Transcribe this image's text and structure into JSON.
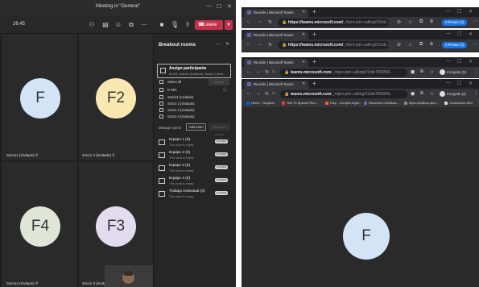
{
  "teams": {
    "window_title": "Meeting in \"General\"",
    "window_controls": [
      "—",
      "☐",
      "✕"
    ],
    "timer": "26:45",
    "leave_label": "Leave",
    "participants": [
      {
        "initials": "F",
        "name": "Sctcio1 (Invitado)",
        "color": "#d2e4f5"
      },
      {
        "initials": "F2",
        "name": "Sctcio 2 (Invitado)",
        "color": "#fbe7b0"
      },
      {
        "initials": "F4",
        "name": "Sctcio4 (Invitado)",
        "color": "#dfe6d8"
      },
      {
        "initials": "F3",
        "name": "Sctcio 3 (Invitado)",
        "color": "#e3dcf1"
      }
    ],
    "breakout": {
      "title": "Breakout rooms",
      "assign_title": "Assign participants",
      "assign_subtitle": "IA MG, Sctcio1 (Invitado), Sctcio 2 (Invit...",
      "assign_button": "Assign",
      "select_all": "Select all",
      "people": [
        "IA MG",
        "Sctcio1 (Invitado)",
        "Sctcio 2 (Invitado)",
        "Sctcio 3 (Invitado)",
        "Sctcio 4 (Invitado)"
      ],
      "manage_rooms": "Manage rooms",
      "add_room": "Add room",
      "recreate": "Recreate rooms",
      "rooms": [
        {
          "name": "Equipo 1 (0)",
          "status": "This room is empty",
          "badge": "CLOSED"
        },
        {
          "name": "Equipo 2 (0)",
          "status": "This room is empty",
          "badge": "CLOSED"
        },
        {
          "name": "Equipo 3 (0)",
          "status": "This room is empty",
          "badge": "CLOSED"
        },
        {
          "name": "Equipo 4 (0)",
          "status": "This room is empty",
          "badge": "CLOSED"
        },
        {
          "name": "Trabajo individual (0)",
          "status": "This room is empty",
          "badge": "CLOSED"
        }
      ]
    }
  },
  "browsers": [
    {
      "tab_title": "Reunión | Microsoft Teams",
      "url": "https://teams.microsoft.com/",
      "url_rest": "_#/pre-join-calling/19:bb...",
      "incognito": "InPrivate (2)",
      "incognito_style": "pill"
    },
    {
      "tab_title": "Reunión | Microsoft Teams",
      "url": "https://teams.microsoft.com/",
      "url_rest": "_#/pre-join-calling/19:bb...",
      "incognito": "InPrivate (2)",
      "incognito_style": "pill"
    },
    {
      "tab_title": "Reunión | Microsoft Teams",
      "url": "teams.microsoft.com",
      "url_rest": "/_#/pre-join-calling/19:bb7f08359...",
      "incognito": "Incognito (2)",
      "incognito_style": "plain"
    },
    {
      "tab_title": "Reunión | Microsoft Teams",
      "url": "teams.microsoft.com",
      "url_rest": "/_#/pre-join-calling/19:bb7f08359...",
      "incognito": "Incognito (2)",
      "incognito_style": "plain",
      "bookmarks": [
        {
          "label": "Home - Dropbox",
          "color": "#0061fe"
        },
        {
          "label": "Text To Speech Rea...",
          "color": "#e0443e"
        },
        {
          "label": "Etsy - Compra regal...",
          "color": "#f16521"
        },
        {
          "label": "Recursos Certificac...",
          "color": "#5c6bc0"
        },
        {
          "label": "https://politeia.upm...",
          "color": "#888888"
        },
        {
          "label": "Confluence ASC",
          "color": "#dddddd"
        }
      ],
      "avatar_initials": "F",
      "avatar_color": "#d2e4f5"
    }
  ]
}
